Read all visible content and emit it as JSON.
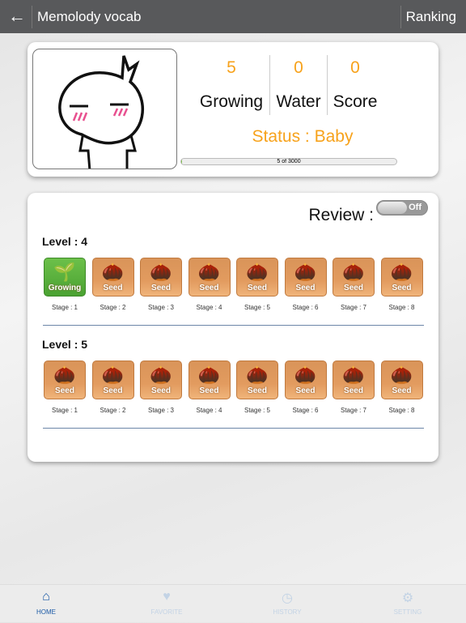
{
  "header": {
    "title": "Memolody vocab",
    "ranking_label": "Ranking"
  },
  "profile": {
    "stats": [
      {
        "value": "5",
        "label": "Growing"
      },
      {
        "value": "0",
        "label": "Water"
      },
      {
        "value": "0",
        "label": "Score"
      }
    ],
    "status": "Status : Baby",
    "progress_text": "5 of 3000",
    "progress_fraction": 0.0017
  },
  "review": {
    "label": "Review :",
    "toggle": "Off"
  },
  "levels": [
    {
      "label": "Level : 4",
      "stages": [
        {
          "tile": "Growing",
          "stage": "Stage : 1"
        },
        {
          "tile": "Seed",
          "stage": "Stage : 2"
        },
        {
          "tile": "Seed",
          "stage": "Stage : 3"
        },
        {
          "tile": "Seed",
          "stage": "Stage : 4"
        },
        {
          "tile": "Seed",
          "stage": "Stage : 5"
        },
        {
          "tile": "Seed",
          "stage": "Stage : 6"
        },
        {
          "tile": "Seed",
          "stage": "Stage : 7"
        },
        {
          "tile": "Seed",
          "stage": "Stage : 8"
        }
      ]
    },
    {
      "label": "Level : 5",
      "stages": [
        {
          "tile": "Seed",
          "stage": "Stage : 1"
        },
        {
          "tile": "Seed",
          "stage": "Stage : 2"
        },
        {
          "tile": "Seed",
          "stage": "Stage : 3"
        },
        {
          "tile": "Seed",
          "stage": "Stage : 4"
        },
        {
          "tile": "Seed",
          "stage": "Stage : 5"
        },
        {
          "tile": "Seed",
          "stage": "Stage : 6"
        },
        {
          "tile": "Seed",
          "stage": "Stage : 7"
        },
        {
          "tile": "Seed",
          "stage": "Stage : 8"
        }
      ]
    }
  ],
  "tabs": [
    {
      "label": "HOME",
      "icon": "home-icon",
      "active": true
    },
    {
      "label": "FAVORITE",
      "icon": "heart-icon"
    },
    {
      "label": "HISTORY",
      "icon": "clock-icon"
    },
    {
      "label": "SETTING",
      "icon": "gear-icon"
    }
  ],
  "colors": {
    "accent": "#f7a21b",
    "header": "#58595b",
    "tab_active": "#1b5aa6"
  }
}
